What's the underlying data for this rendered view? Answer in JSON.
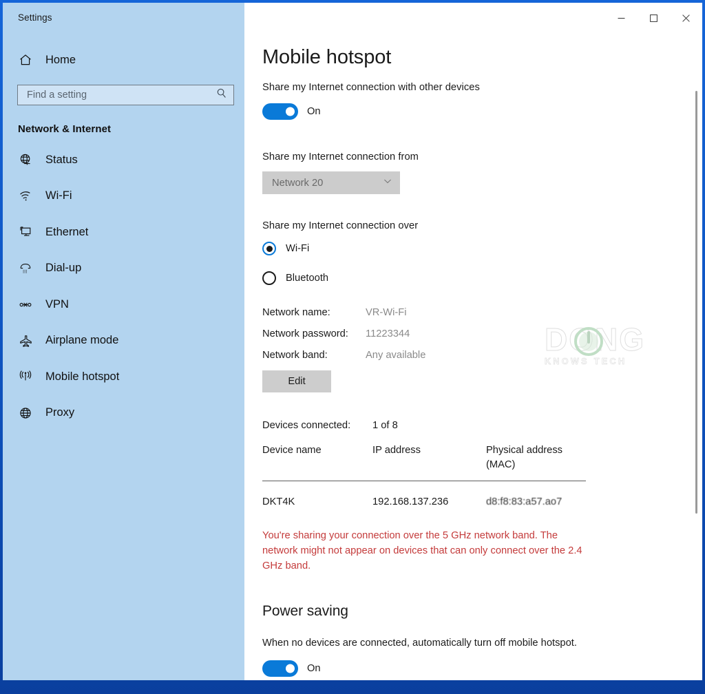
{
  "window": {
    "title": "Settings",
    "controls": [
      {
        "name": "minimize",
        "glyph": "minimize-icon"
      },
      {
        "name": "maximize",
        "glyph": "maximize-icon"
      },
      {
        "name": "close",
        "glyph": "close-icon"
      }
    ]
  },
  "sidebar": {
    "home_label": "Home",
    "search": {
      "placeholder": "Find a setting",
      "value": ""
    },
    "category": "Network & Internet",
    "items": [
      {
        "label": "Status",
        "icon": "globe-status-icon",
        "selected": false
      },
      {
        "label": "Wi-Fi",
        "icon": "wifi-icon",
        "selected": false
      },
      {
        "label": "Ethernet",
        "icon": "ethernet-icon",
        "selected": false
      },
      {
        "label": "Dial-up",
        "icon": "dialup-phone-icon",
        "selected": false
      },
      {
        "label": "VPN",
        "icon": "vpn-icon",
        "selected": false
      },
      {
        "label": "Airplane mode",
        "icon": "airplane-icon",
        "selected": false
      },
      {
        "label": "Mobile hotspot",
        "icon": "hotspot-icon",
        "selected": true
      },
      {
        "label": "Proxy",
        "icon": "globe-proxy-icon",
        "selected": false
      }
    ]
  },
  "main": {
    "page_title": "Mobile hotspot",
    "share_section": {
      "label": "Share my Internet connection with other devices",
      "toggle_state": "On"
    },
    "share_from": {
      "label": "Share my Internet connection from",
      "selected_option": "Network 20"
    },
    "share_over": {
      "label": "Share my Internet connection over",
      "options": [
        {
          "label": "Wi-Fi",
          "checked": true
        },
        {
          "label": "Bluetooth",
          "checked": false
        }
      ]
    },
    "network_details": [
      {
        "key": "Network name:",
        "value": "VR-Wi-Fi"
      },
      {
        "key": "Network password:",
        "value": "11223344"
      },
      {
        "key": "Network band:",
        "value": "Any available"
      }
    ],
    "edit_button": "Edit",
    "devices": {
      "count_label": "Devices connected:",
      "count_value": "1 of 8",
      "columns": [
        "Device name",
        "IP address",
        "Physical address (MAC)"
      ],
      "rows": [
        {
          "device_name": "DKT4K",
          "ip_address": "192.168.137.236",
          "mac_address": "d8:f8:83:a57.ao7"
        }
      ]
    },
    "warning": "You're sharing your connection over the 5 GHz network band. The network might not appear on devices that can only connect over the 2.4 GHz band.",
    "power_saving": {
      "heading": "Power saving",
      "description": "When no devices are connected, automatically turn off mobile hotspot.",
      "toggle_state": "On"
    }
  },
  "watermark": {
    "text": "DONG",
    "subtext": "KNOWS TECH"
  },
  "colors": {
    "accent": "#0a7ad8",
    "sidebar_bg": "#b3d4ef",
    "warning": "#c43b3b",
    "selection_bar": "#0a5fb4",
    "desktop": "#0f56c4"
  }
}
